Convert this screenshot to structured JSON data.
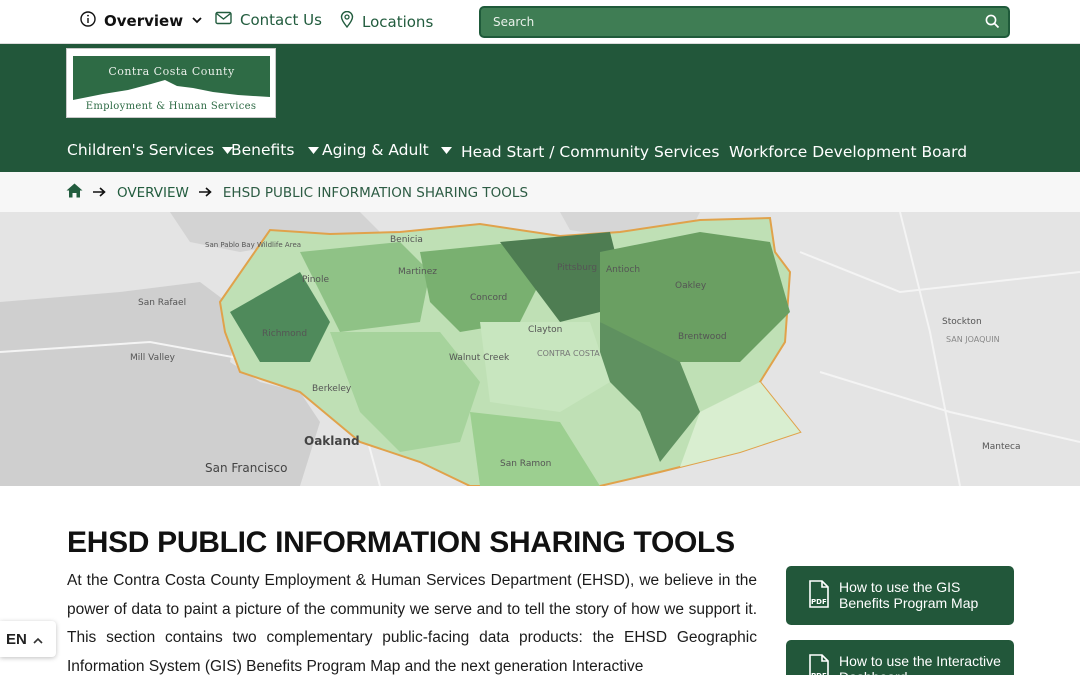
{
  "utility_nav": {
    "overview": "Overview",
    "contact": "Contact Us",
    "locations": "Locations"
  },
  "search": {
    "placeholder": "Search"
  },
  "logo": {
    "line1": "Contra Costa County",
    "line2": "Employment & Human Services"
  },
  "main_nav": {
    "items": [
      {
        "label": "Children's Services",
        "has_dropdown": true
      },
      {
        "label": "Benefits",
        "has_dropdown": true
      },
      {
        "label": "Aging & Adult",
        "has_dropdown": true
      },
      {
        "label": "Head Start / Community Services",
        "has_dropdown": false
      },
      {
        "label": "Workforce Development Board",
        "has_dropdown": false
      }
    ]
  },
  "breadcrumb": {
    "items": [
      "OVERVIEW",
      "EHSD PUBLIC INFORMATION SHARING TOOLS"
    ]
  },
  "map": {
    "labels": [
      "Benicia",
      "San Pablo Bay Wildlife Area",
      "Pinole",
      "Martinez",
      "Pittsburg",
      "Antioch",
      "Oakley",
      "San Rafael",
      "Concord",
      "Clayton",
      "CONTRA COSTA",
      "Brentwood",
      "Richmond",
      "Mill Valley",
      "Walnut Creek",
      "Berkeley",
      "Oakland",
      "San Francisco",
      "San Ramon",
      "Stockton",
      "SAN JOAQUIN",
      "Manteca"
    ]
  },
  "content": {
    "title": "EHSD PUBLIC INFORMATION SHARING TOOLS",
    "intro": "At the Contra Costa County Employment & Human Services Department (EHSD), we believe in the power of data to paint a picture of the community we serve and to tell the story of how we support it. This section contains two complementary public-facing data products: the EHSD Geographic Information System (GIS) Benefits Program Map and the next generation Interactive"
  },
  "sidebar_cards": [
    {
      "label": "How to use the GIS Benefits Program Map",
      "icon": "pdf-icon"
    },
    {
      "label": "How to use the Interactive Dashboard",
      "icon": "pdf-icon"
    }
  ],
  "language": {
    "code": "EN"
  },
  "colors": {
    "brand_green": "#22573a",
    "search_green": "#3f7d54"
  }
}
